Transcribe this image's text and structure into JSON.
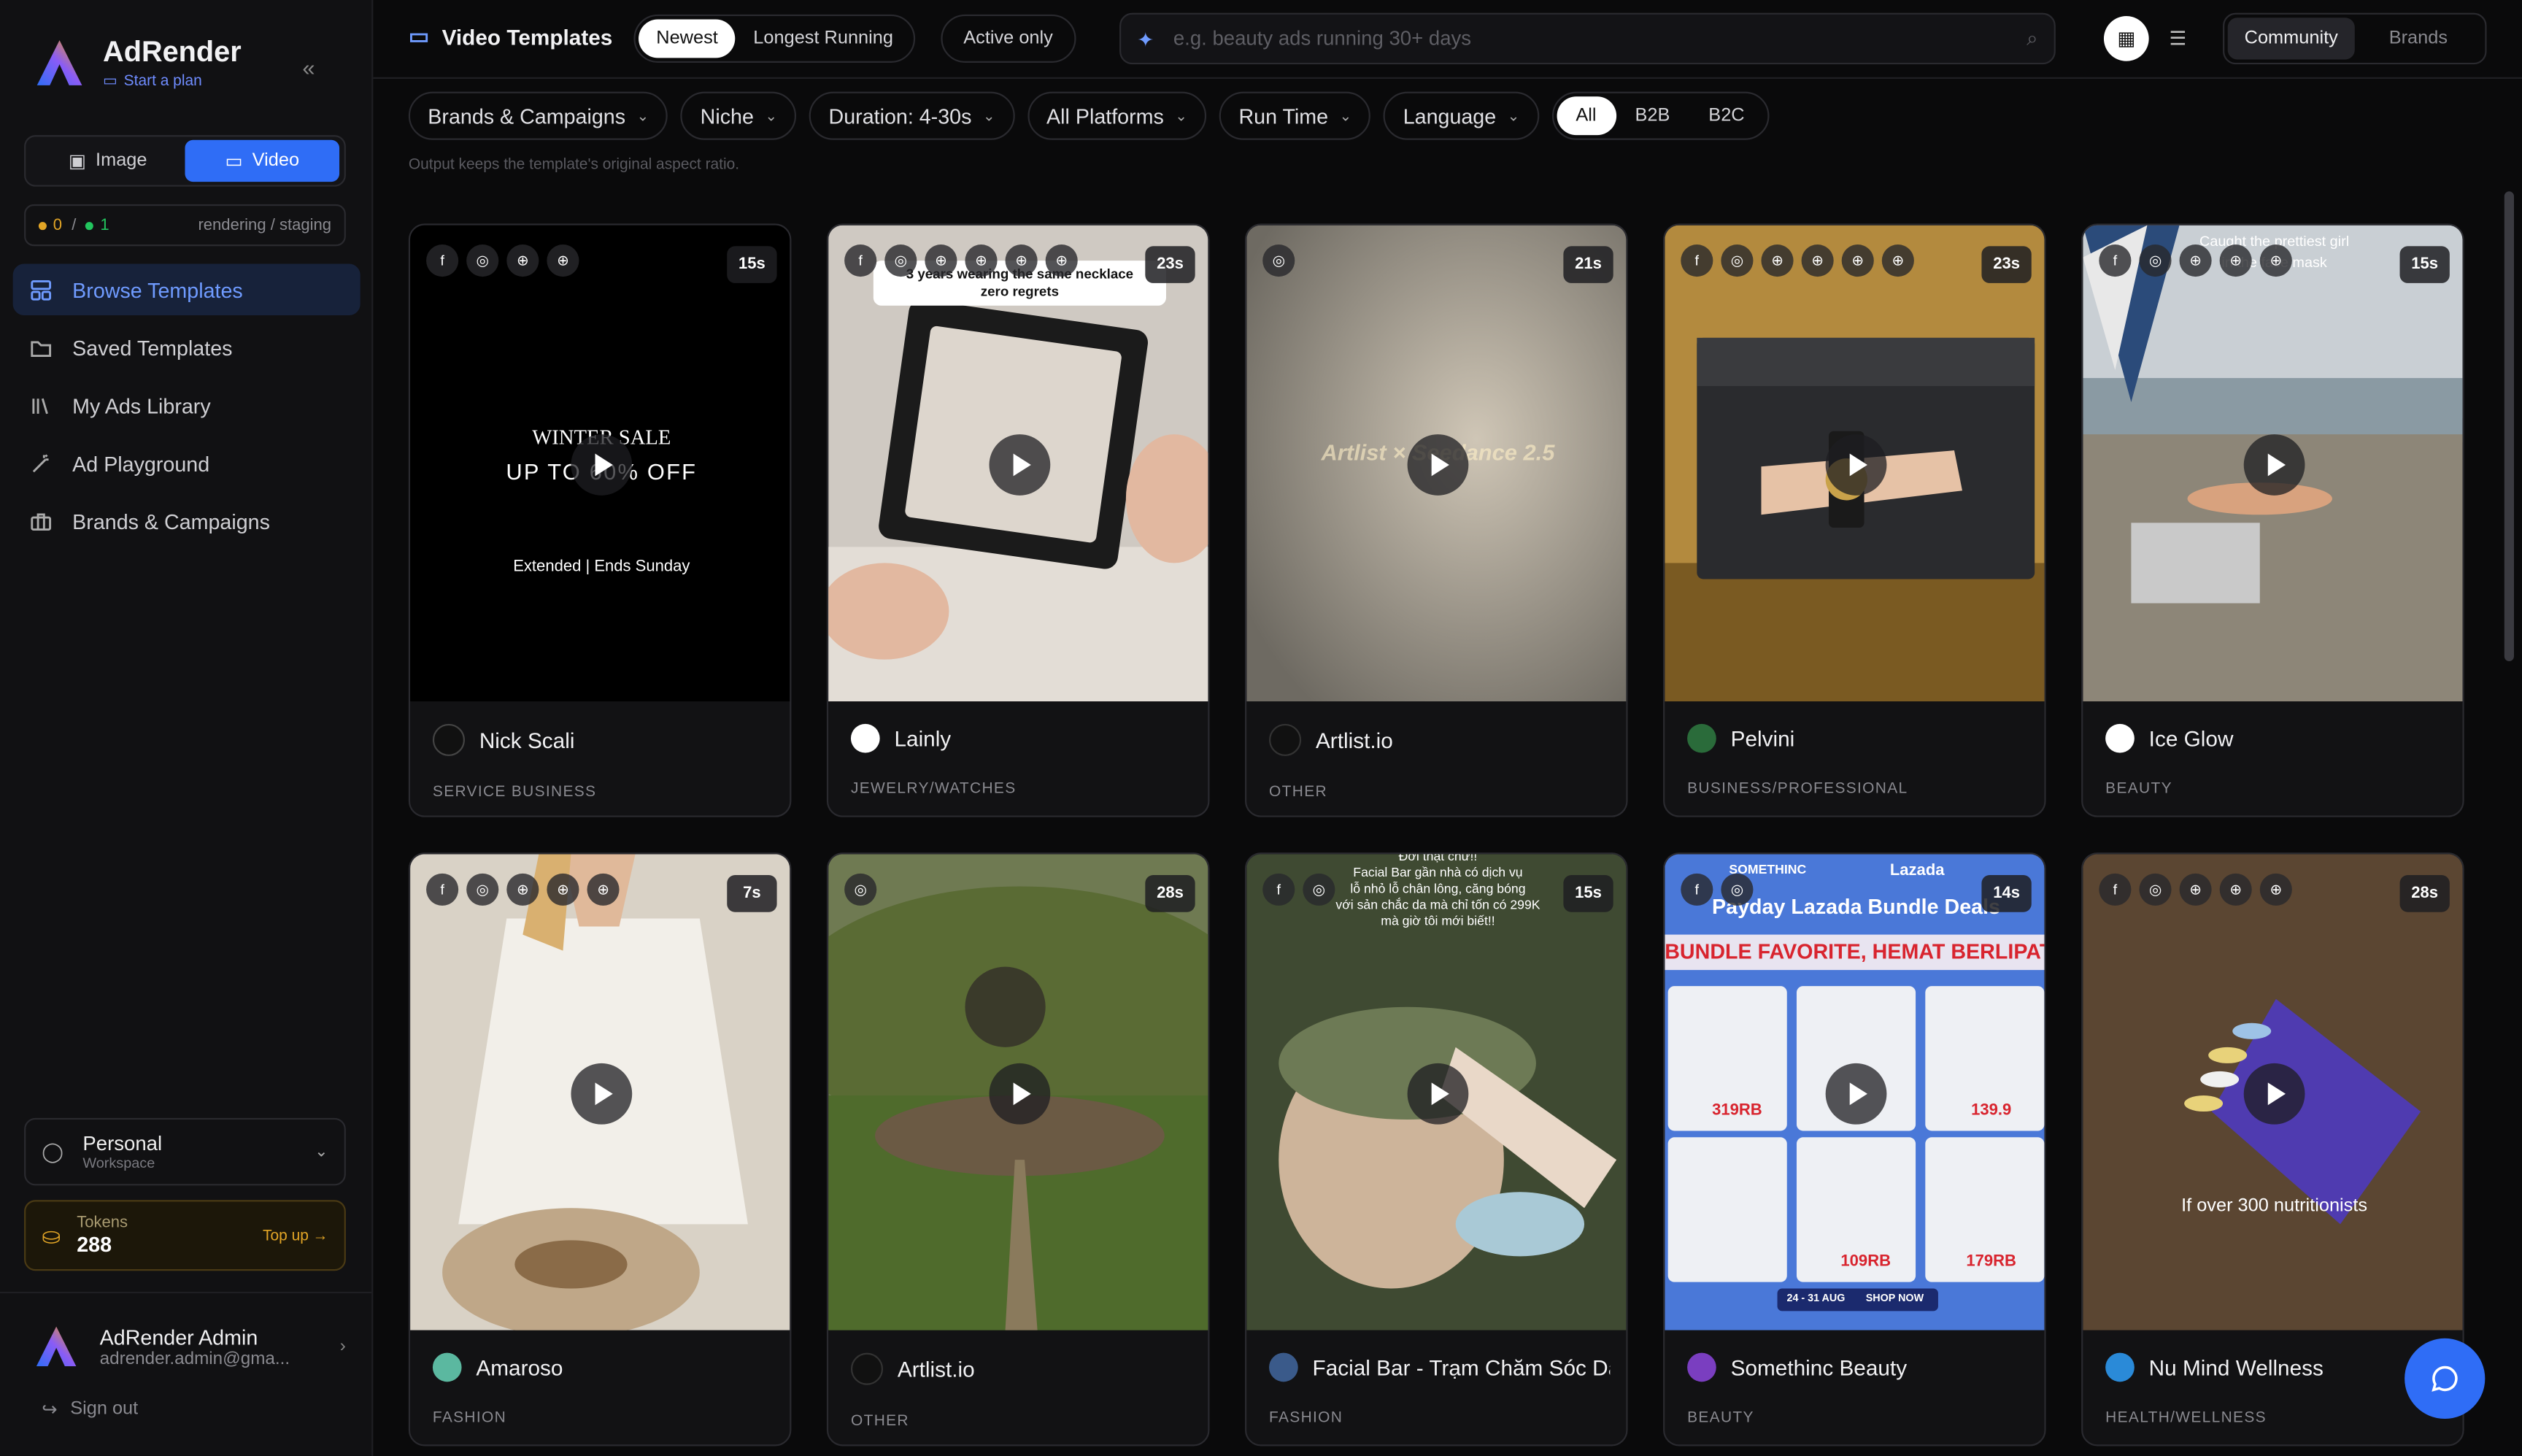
{
  "sidebar": {
    "brand": "AdRender",
    "plan_link": "Start a plan",
    "mode": {
      "image": "Image",
      "video": "Video"
    },
    "status": {
      "queued": "0",
      "sep": "/",
      "done": "1",
      "env": "rendering / staging"
    },
    "nav": [
      {
        "label": "Browse Templates"
      },
      {
        "label": "Saved Templates"
      },
      {
        "label": "My Ads Library"
      },
      {
        "label": "Ad Playground"
      },
      {
        "label": "Brands & Campaigns"
      }
    ],
    "workspace": {
      "name": "Personal",
      "sub": "Workspace"
    },
    "tokens": {
      "label": "Tokens",
      "value": "288",
      "topup": "Top up →"
    },
    "user": {
      "name": "AdRender Admin",
      "email": "adrender.admin@gma..."
    },
    "signout": "Sign out"
  },
  "topbar": {
    "title": "Video Templates",
    "sort": {
      "newest": "Newest",
      "longest": "Longest Running"
    },
    "active_only": "Active only",
    "search_placeholder": "e.g. beauty ads running 30+ days",
    "source": {
      "community": "Community",
      "brands": "Brands"
    }
  },
  "filters": {
    "brands": "Brands & Campaigns",
    "niche": "Niche",
    "duration": "Duration: 4-30s",
    "platforms": "All Platforms",
    "runtime": "Run Time",
    "language": "Language",
    "audience": {
      "all": "All",
      "b2b": "B2B",
      "b2c": "B2C"
    },
    "note": "Output keeps the template's original aspect ratio."
  },
  "cards": [
    {
      "advertiser": "Nick Scali",
      "niche": "SERVICE BUSINESS",
      "duration": "15s",
      "overlay": [
        "WINTER SALE",
        "UP TO 60% OFF",
        "Extended | Ends Sunday"
      ]
    },
    {
      "advertiser": "Lainly",
      "niche": "JEWELRY/WATCHES",
      "duration": "23s",
      "overlay": [
        "3 years wearing the same necklace",
        "zero regrets"
      ]
    },
    {
      "advertiser": "Artlist.io",
      "niche": "OTHER",
      "duration": "21s",
      "overlay": [
        "Artlist × Seedance 2.5"
      ]
    },
    {
      "advertiser": "Pelvini",
      "niche": "BUSINESS/PROFESSIONAL",
      "duration": "23s",
      "overlay": []
    },
    {
      "advertiser": "Ice Glow",
      "niche": "BEAUTY",
      "duration": "15s",
      "overlay": [
        "Caught the prettiest girl",
        "in the face mask"
      ]
    },
    {
      "advertiser": "Amaroso",
      "niche": "FASHION",
      "duration": "7s",
      "overlay": []
    },
    {
      "advertiser": "Artlist.io",
      "niche": "OTHER",
      "duration": "28s",
      "overlay": []
    },
    {
      "advertiser": "Facial Bar - Trạm Chăm Sóc Da",
      "niche": "FASHION",
      "duration": "15s",
      "overlay": [
        "Đời thật chứ!!",
        "Facial Bar gần nhà có dịch vụ",
        "lỗ nhỏ lỗ chân lông, căng bóng",
        "với sản chắc da mà chỉ tốn có 299K",
        "mà giờ tôi mới biết!!"
      ]
    },
    {
      "advertiser": "Somethinc Beauty",
      "niche": "BEAUTY",
      "duration": "14s",
      "overlay": [
        "SOMETHINC",
        "Lazada",
        "Payday Lazada Bundle Deals",
        "BUNDLE FAVORITE, HEMAT BERLIPAT",
        "319RB",
        "109RB",
        "139.9",
        "179RB",
        "24 - 31 AUG",
        "SHOP NOW"
      ]
    },
    {
      "advertiser": "Nu Mind Wellness",
      "niche": "HEALTH/WELLNESS",
      "duration": "28s",
      "overlay": [
        "If over 300 nutritionists"
      ]
    }
  ],
  "colors": {
    "accent": "#2f6df6",
    "active_nav_bg": "#17223a",
    "active_nav_text": "#6f9bff",
    "token_accent": "#e2a526"
  }
}
